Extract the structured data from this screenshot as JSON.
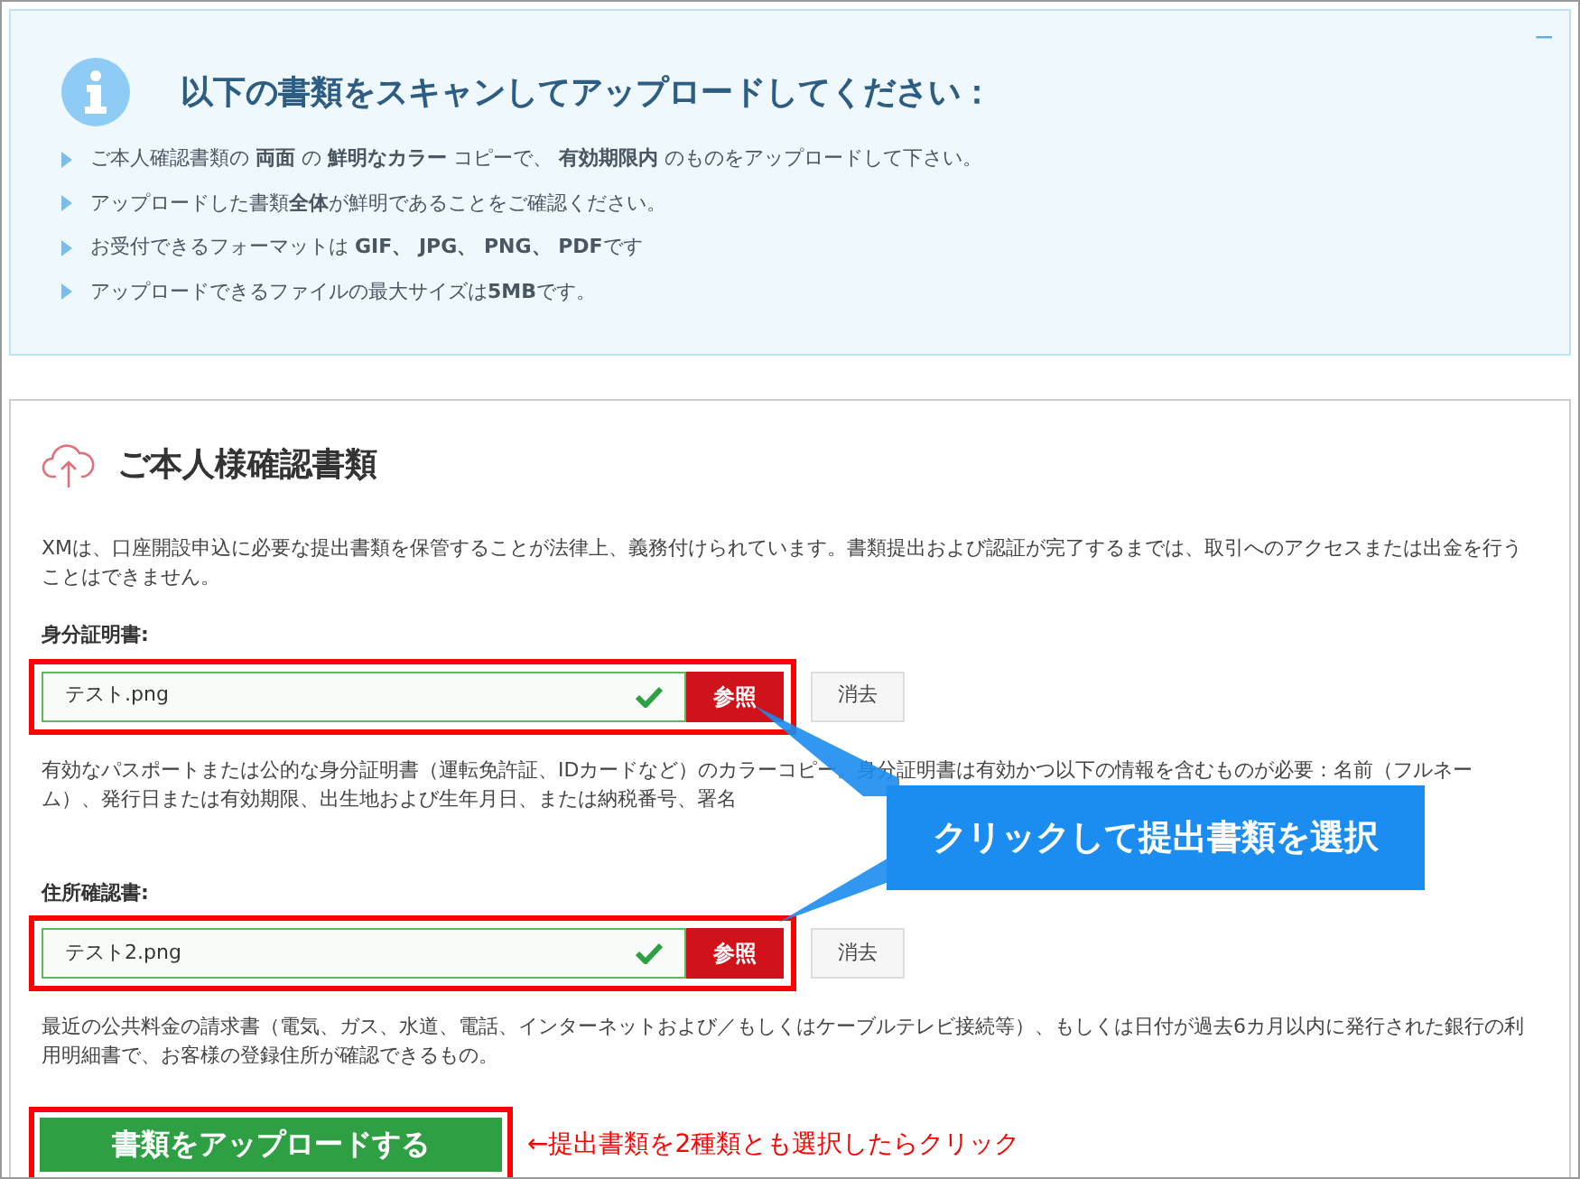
{
  "info": {
    "collapse": "−",
    "title": "以下の書類をスキャンしてアップロードしてください：",
    "items": [
      "ご本人確認書類の **両面** の **鮮明なカラー** コピーで、 **有効期限内** のものをアップロードして下さい。",
      "アップロードした書類**全体**が鮮明であることをご確認ください。",
      "お受付できるフォーマットは **GIF、 JPG、 PNG、 PDF**です",
      "アップロードできるファイルの最大サイズは**5MB**です。"
    ]
  },
  "section": {
    "title": "ご本人様確認書類",
    "intro": "XMは、口座開設申込に必要な提出書類を保管することが法律上、義務付けられています。書類提出および認証が完了するまでは、取引へのアクセスまたは出金を行うことはできません。",
    "documents": [
      {
        "label": "身分証明書:",
        "filename": "テスト.png",
        "valid": true,
        "browse": "参照",
        "clear": "消去",
        "note": "有効なパスポートまたは公的な身分証明書（運転免許証、IDカードなど）のカラーコピー。身分証明書は有効かつ以下の情報を含むものが必要：名前（フルネーム）、発行日または有効期限、出生地および生年月日、または納税番号、署名"
      },
      {
        "label": "住所確認書:",
        "filename": "テスト2.png",
        "valid": true,
        "browse": "参照",
        "clear": "消去",
        "note": "最近の公共料金の請求書（電気、ガス、水道、電話、インターネットおよび／もしくはケーブルテレビ接続等）、もしくは日付が過去6カ月以内に発行された銀行の利用明細書で、お客様の登録住所が確認できるもの。"
      }
    ],
    "submit": "書類をアップロードする"
  },
  "callout": "クリックして提出書類を選択",
  "annotation": "←提出書類を2種類とも選択したらクリック"
}
